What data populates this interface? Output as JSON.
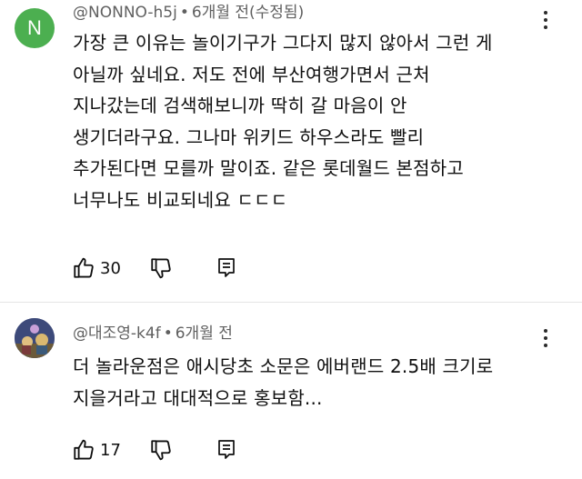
{
  "comments": [
    {
      "avatar_letter": "N",
      "avatar_color": "#4caf50",
      "author": "@NONNO-h5j",
      "time": "6개월 전(수정됨)",
      "lines": [
        "가장 큰 이유는 놀이기구가 그다지 많지 않아서 그런 게",
        "아닐까 싶네요. 저도 전에 부산여행가면서 근처",
        "지나갔는데 검색해보니까 딱히 갈 마음이 안",
        "생기더라구요. 그나마 위키드 하우스라도 빨리",
        "추가된다면 모를까 말이죠. 같은 롯데월드 본점하고",
        "너무나도 비교되네요 ㄷㄷㄷ"
      ],
      "likes": "30"
    },
    {
      "avatar_letter": "",
      "avatar_color": "#3d4a7a",
      "author": "@대조영-k4f",
      "time": "6개월 전",
      "lines": [
        "더 놀라운점은 애시당초 소문은 에버랜드 2.5배 크기로",
        "지을거라고 대대적으로 홍보함..."
      ],
      "likes": "17"
    }
  ],
  "icons": {
    "like": "thumb-up-icon",
    "dislike": "thumb-down-icon",
    "reply": "reply-icon",
    "more": "kebab-icon"
  }
}
